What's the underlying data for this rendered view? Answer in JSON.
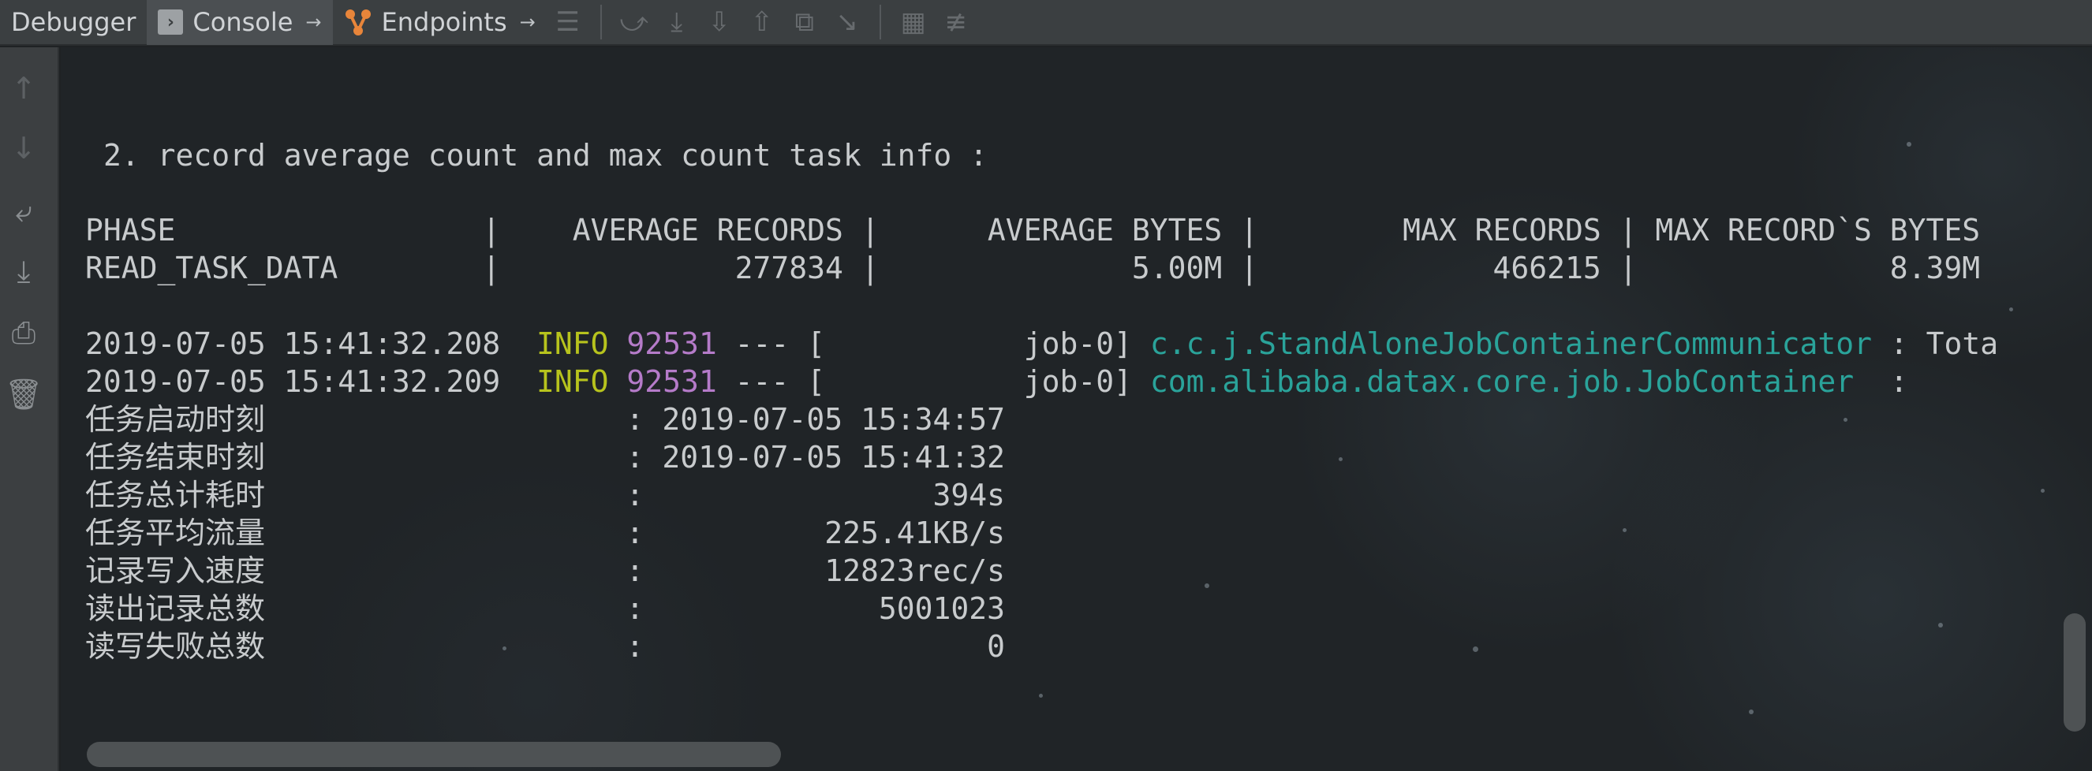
{
  "toolbar": {
    "tabs": [
      {
        "label": "Debugger"
      },
      {
        "label": "Console",
        "pin": "→"
      },
      {
        "label": "Endpoints",
        "pin": "→"
      }
    ]
  },
  "console": {
    "header": "2. record average count and max count task info :",
    "table": {
      "header": "PHASE                 |    AVERAGE RECORDS |      AVERAGE BYTES |        MAX RECORDS | MAX RECORD`S BYTES",
      "row": "READ_TASK_DATA        |             277834 |              5.00M |             466215 |              8.39M"
    },
    "logs": [
      {
        "timestamp": "2019-07-05 15:41:32.208",
        "level": "INFO",
        "pid": "92531",
        "thread": " --- [           job-0] ",
        "logger": "c.c.j.StandAloneJobContainerCommunicator",
        "message": " : Tota"
      },
      {
        "timestamp": "2019-07-05 15:41:32.209",
        "level": "INFO",
        "pid": "92531",
        "thread": " --- [           job-0] ",
        "logger": "com.alibaba.datax.core.job.JobContainer ",
        "message": " :"
      }
    ],
    "summary": [
      "任务启动时刻                    : 2019-07-05 15:34:57",
      "任务结束时刻                    : 2019-07-05 15:41:32",
      "任务总计耗时                    :                394s",
      "任务平均流量                    :          225.41KB/s",
      "记录写入速度                    :          12823rec/s",
      "读出记录总数                    :             5001023",
      "读写失败总数                    :                   0"
    ]
  }
}
